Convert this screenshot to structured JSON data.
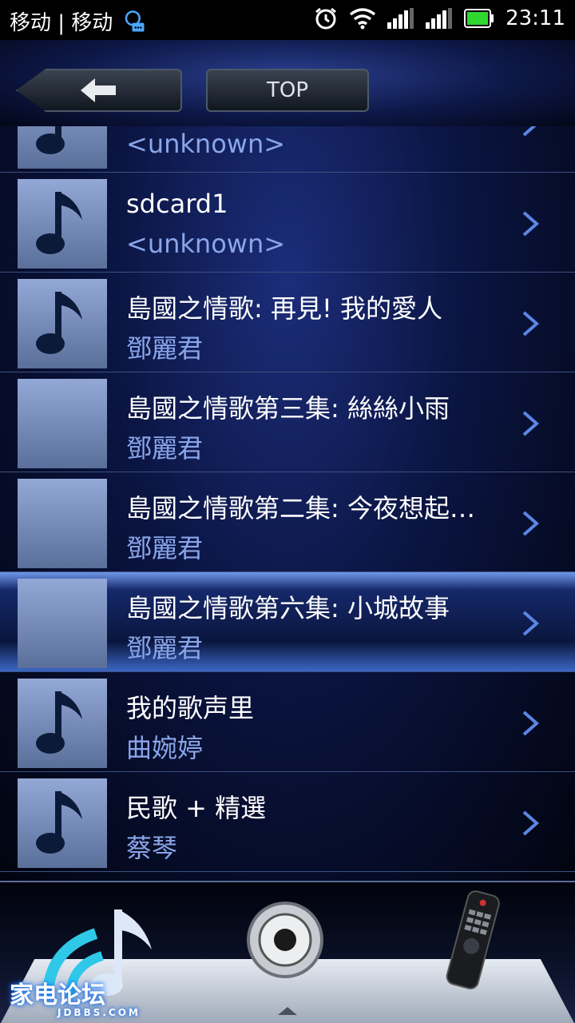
{
  "status_bar": {
    "carrier": "移动 | 移动",
    "time": "23:11"
  },
  "toolbar": {
    "back_icon": "arrow-left-icon",
    "top_label": "TOP"
  },
  "list": {
    "items": [
      {
        "title": "",
        "subtitle": "<unknown>",
        "art": "music-note-icon"
      },
      {
        "title": "sdcard1",
        "subtitle": "<unknown>",
        "art": "music-note-icon"
      },
      {
        "title": "島國之情歌: 再見! 我的愛人",
        "subtitle": "鄧麗君",
        "art": "music-note-icon"
      },
      {
        "title": "島國之情歌第三集: 絲絲小雨",
        "subtitle": "鄧麗君",
        "art": "album-art"
      },
      {
        "title": "島國之情歌第二集: 今夜想起…",
        "subtitle": "鄧麗君",
        "art": "album-art"
      },
      {
        "title": "島國之情歌第六集: 小城故事",
        "subtitle": "鄧麗君",
        "art": "album-art",
        "selected": true
      },
      {
        "title": "我的歌声里",
        "subtitle": "曲婉婷",
        "art": "music-note-icon"
      },
      {
        "title": "民歌 + 精選",
        "subtitle": "蔡琴",
        "art": "music-note-icon"
      }
    ]
  },
  "dock": {
    "buttons": [
      "wifi-music-icon",
      "speaker-icon",
      "remote-control-icon"
    ]
  },
  "watermark": {
    "text": "家电论坛",
    "subtext": "JDBBS.COM"
  },
  "colors": {
    "subtitle": "#8aa6ea",
    "accent": "#3b67c6"
  }
}
